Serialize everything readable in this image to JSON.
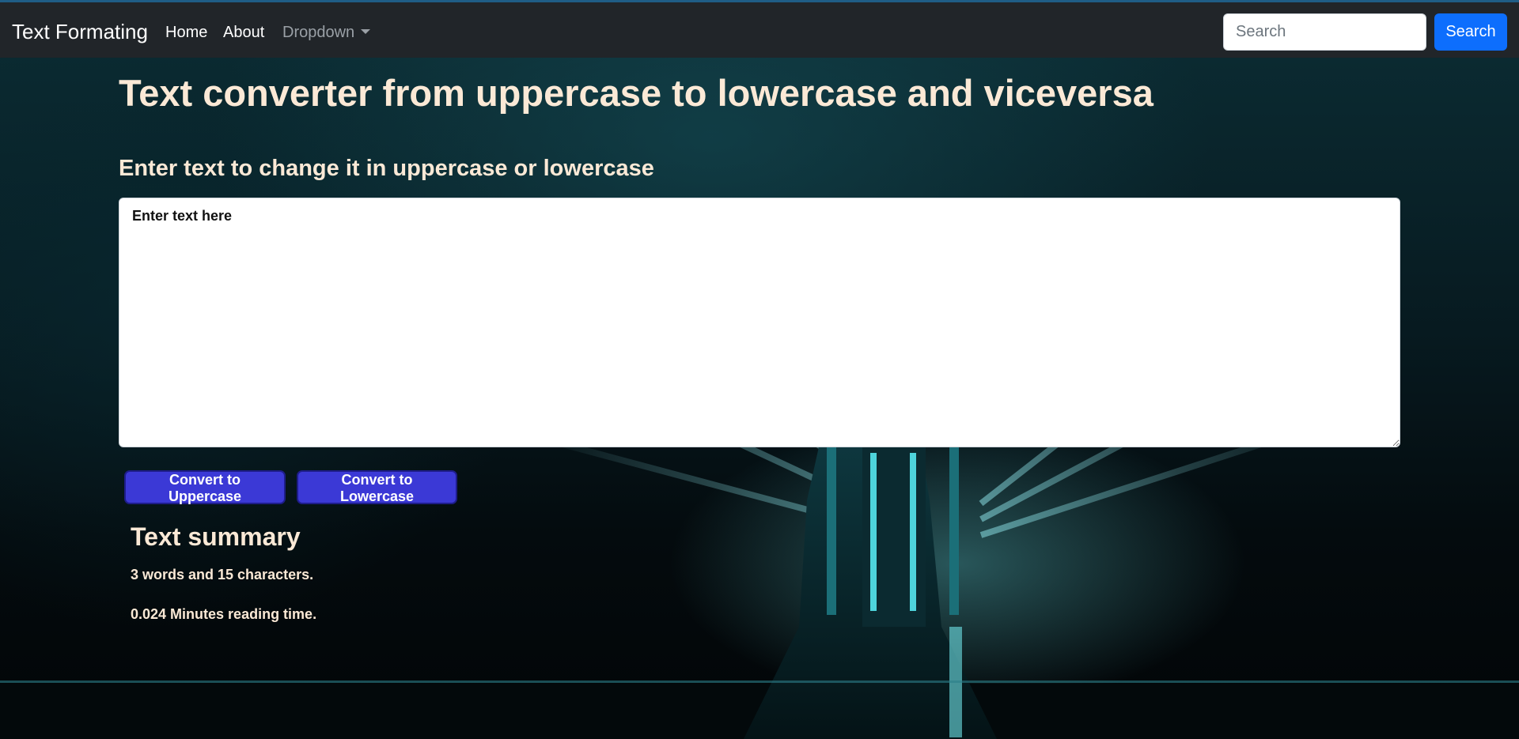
{
  "navbar": {
    "brand": "Text Formating",
    "links": [
      {
        "label": "Home"
      },
      {
        "label": "About"
      },
      {
        "label": "Dropdown"
      }
    ],
    "search_placeholder": "Search",
    "search_button": "Search"
  },
  "main": {
    "title": "Text converter from uppercase to lowercase and viceversa",
    "subtitle": "Enter text to change it in uppercase or lowercase",
    "textarea_placeholder": "Enter text here",
    "buttons": {
      "uppercase": "Convert to Uppercase",
      "lowercase": "Convert to Lowercase"
    }
  },
  "summary": {
    "title": "Text summary",
    "counts": "3 words and 15 characters.",
    "reading_time": "0.024 Minutes reading time."
  },
  "colors": {
    "navbar": "#212529",
    "accent": "#0d6efd",
    "convert_button": "#3b39d6",
    "heading_text": "#fbe9d6"
  }
}
